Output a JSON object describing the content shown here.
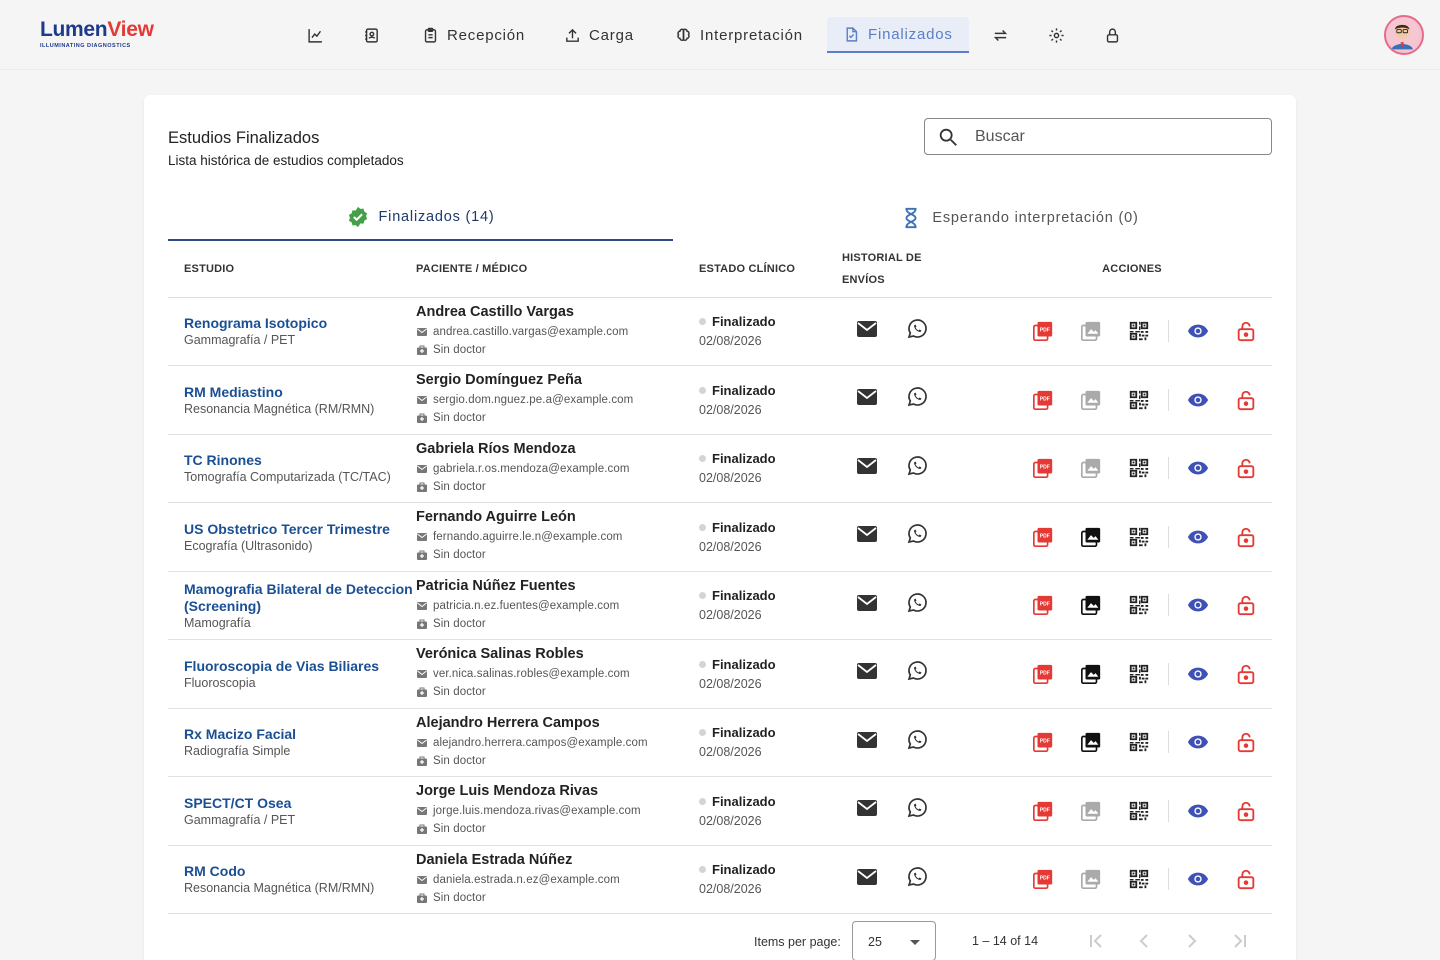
{
  "app": {
    "logo_part1": "Lumen",
    "logo_part2": "View",
    "logo_tagline": "ILLUMINATING DIAGNOSTICS"
  },
  "nav": {
    "items": [
      {
        "label": "",
        "icon": "chart-icon"
      },
      {
        "label": "",
        "icon": "contacts-icon"
      },
      {
        "label": "Recepción",
        "icon": "clipboard-icon"
      },
      {
        "label": "Carga",
        "icon": "upload-icon"
      },
      {
        "label": "Interpretación",
        "icon": "brain-icon"
      },
      {
        "label": "Finalizados",
        "icon": "document-icon",
        "active": true
      },
      {
        "label": "",
        "icon": "transfer-icon"
      },
      {
        "label": "",
        "icon": "gear-icon"
      },
      {
        "label": "",
        "icon": "lock-icon"
      }
    ]
  },
  "page": {
    "title": "Estudios Finalizados",
    "subtitle": "Lista histórica de estudios completados",
    "search_placeholder": "Buscar"
  },
  "tabs": [
    {
      "label": "Finalizados (14)",
      "icon": "verified-icon",
      "active": true
    },
    {
      "label": "Esperando interpretación (0)",
      "icon": "hourglass-icon",
      "active": false
    }
  ],
  "table": {
    "headers": {
      "study": "ESTUDIO",
      "patient": "PACIENTE / MÉDICO",
      "state": "ESTADO CLÍNICO",
      "history_1": "HISTORIAL DE",
      "history_2": "ENVÍOS",
      "actions": "ACCIONES"
    },
    "rows": [
      {
        "study": "Renograma Isotopico",
        "type": "Gammagrafía / PET",
        "patient": "Andrea Castillo Vargas",
        "email": "andrea.castillo.vargas@example.com",
        "doctor": "Sin doctor",
        "state": "Finalizado",
        "date": "02/08/2026",
        "images": false
      },
      {
        "study": "RM Mediastino",
        "type": "Resonancia Magnética (RM/RMN)",
        "patient": "Sergio Domínguez Peña",
        "email": "sergio.dom.nguez.pe.a@example.com",
        "doctor": "Sin doctor",
        "state": "Finalizado",
        "date": "02/08/2026",
        "images": false
      },
      {
        "study": "TC Rinones",
        "type": "Tomografía Computarizada (TC/TAC)",
        "patient": "Gabriela Ríos Mendoza",
        "email": "gabriela.r.os.mendoza@example.com",
        "doctor": "Sin doctor",
        "state": "Finalizado",
        "date": "02/08/2026",
        "images": false
      },
      {
        "study": "US Obstetrico Tercer Trimestre",
        "type": "Ecografía (Ultrasonido)",
        "patient": "Fernando Aguirre León",
        "email": "fernando.aguirre.le.n@example.com",
        "doctor": "Sin doctor",
        "state": "Finalizado",
        "date": "02/08/2026",
        "images": true
      },
      {
        "study": "Mamografia Bilateral de Deteccion (Screening)",
        "type": "Mamografía",
        "patient": "Patricia Núñez Fuentes",
        "email": "patricia.n.ez.fuentes@example.com",
        "doctor": "Sin doctor",
        "state": "Finalizado",
        "date": "02/08/2026",
        "images": true
      },
      {
        "study": "Fluoroscopia de Vias Biliares",
        "type": "Fluoroscopia",
        "patient": "Verónica Salinas Robles",
        "email": "ver.nica.salinas.robles@example.com",
        "doctor": "Sin doctor",
        "state": "Finalizado",
        "date": "02/08/2026",
        "images": true
      },
      {
        "study": "Rx Macizo Facial",
        "type": "Radiografía Simple",
        "patient": "Alejandro Herrera Campos",
        "email": "alejandro.herrera.campos@example.com",
        "doctor": "Sin doctor",
        "state": "Finalizado",
        "date": "02/08/2026",
        "images": true
      },
      {
        "study": "SPECT/CT Osea",
        "type": "Gammagrafía / PET",
        "patient": "Jorge Luis Mendoza Rivas",
        "email": "jorge.luis.mendoza.rivas@example.com",
        "doctor": "Sin doctor",
        "state": "Finalizado",
        "date": "02/08/2026",
        "images": false
      },
      {
        "study": "RM Codo",
        "type": "Resonancia Magnética (RM/RMN)",
        "patient": "Daniela Estrada Núñez",
        "email": "daniela.estrada.n.ez@example.com",
        "doctor": "Sin doctor",
        "state": "Finalizado",
        "date": "02/08/2026",
        "images": false
      }
    ]
  },
  "pager": {
    "label": "Items per page:",
    "page_size": "25",
    "range": "1 – 14 of 14"
  },
  "colors": {
    "primary": "#1a4f93",
    "accent_red": "#e53935",
    "eye_blue": "#3f51b5",
    "tab_active": "#2c4a86",
    "finalizado_dot": "#d4d4d4"
  }
}
